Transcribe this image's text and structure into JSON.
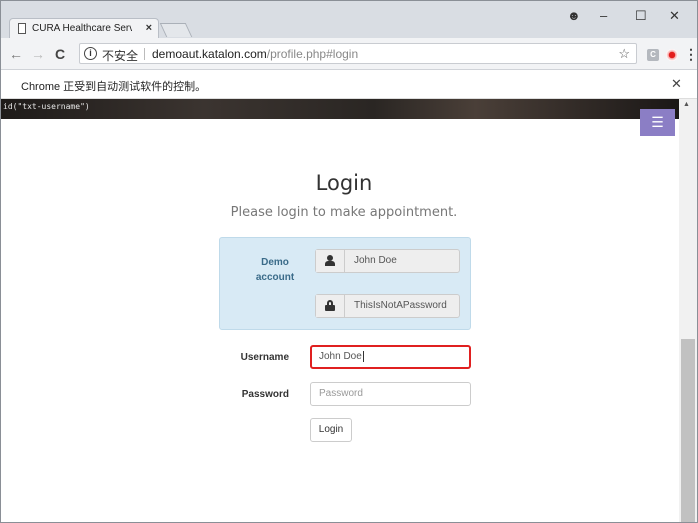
{
  "browser": {
    "tab_title": "CURA Healthcare Servi",
    "url_security": "不安全",
    "url_host": "demoaut.katalon.com",
    "url_path": "/profile.php#login",
    "infobar_message": "Chrome 正受到自动测试软件的控制。",
    "ext_badge": "C"
  },
  "page": {
    "debug_text": "id(\"txt-username\")",
    "title": "Login",
    "subtitle": "Please login to make appointment.",
    "demo": {
      "label_line1": "Demo",
      "label_line2": "account",
      "username": "John Doe",
      "password": "ThisIsNotAPassword"
    },
    "form": {
      "username_label": "Username",
      "username_value": "John Doe",
      "password_label": "Password",
      "password_placeholder": "Password",
      "login_button": "Login"
    }
  },
  "icons": {
    "user": "user-icon",
    "lock": "lock-icon",
    "menu": "hamburger-icon"
  }
}
